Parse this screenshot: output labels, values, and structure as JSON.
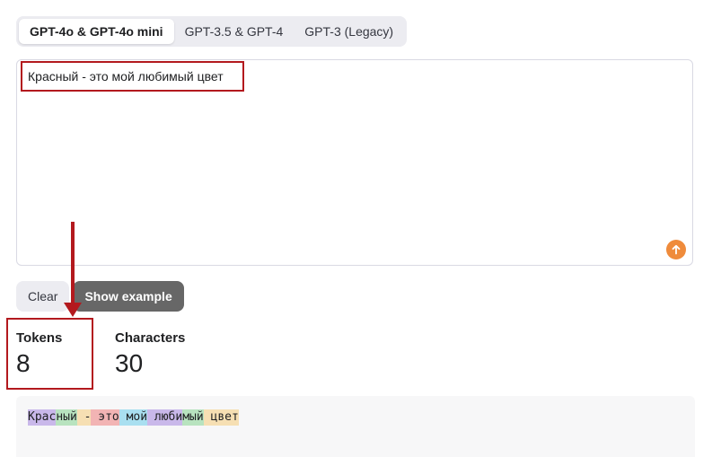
{
  "tabs": [
    {
      "label": "GPT-4o & GPT-4o mini",
      "active": true
    },
    {
      "label": "GPT-3.5 & GPT-4",
      "active": false
    },
    {
      "label": "GPT-3 (Legacy)",
      "active": false
    }
  ],
  "editor": {
    "text": "Красный - это мой любимый цвет",
    "submit_icon": "arrow-up-icon",
    "submit_color": "#ef8b3b"
  },
  "buttons": {
    "clear_label": "Clear",
    "example_label": "Show example"
  },
  "stats": {
    "tokens_label": "Tokens",
    "tokens_value": "8",
    "characters_label": "Characters",
    "characters_value": "30"
  },
  "tokens": [
    {
      "text": "Крас",
      "color": "#c9b8ea"
    },
    {
      "text": "ный",
      "color": "#b8e3bf"
    },
    {
      "text": " -",
      "color": "#f6dfb3"
    },
    {
      "text": " это",
      "color": "#f2b4b4"
    },
    {
      "text": " мой",
      "color": "#a9dff0"
    },
    {
      "text": " люби",
      "color": "#c9b8ea"
    },
    {
      "text": "мый",
      "color": "#b8e3bf"
    },
    {
      "text": " цвет",
      "color": "#f6dfb3"
    }
  ],
  "annotation_color": "#b3191e"
}
